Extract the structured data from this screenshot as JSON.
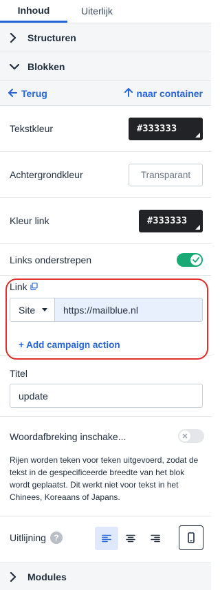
{
  "tabs": [
    {
      "label": "Inhoud",
      "active": true
    },
    {
      "label": "Uiterlijk",
      "active": false
    }
  ],
  "sections": {
    "structuren": "Structuren",
    "blokken": "Blokken",
    "modules": "Modules"
  },
  "nav": {
    "back": "Terug",
    "container": "naar container"
  },
  "fields": {
    "tekstkleur": {
      "label": "Tekstkleur",
      "value": "#333333"
    },
    "achtergrondkleur": {
      "label": "Achtergrondkleur",
      "placeholder": "Transparant"
    },
    "kleur_link": {
      "label": "Kleur link",
      "value": "#333333"
    },
    "links_onderstrepen": {
      "label": "Links onderstrepen",
      "enabled": true
    }
  },
  "link": {
    "label": "Link",
    "type_selected": "Site",
    "url": "https://mailblue.nl",
    "add_action": "+ Add campaign action"
  },
  "titel": {
    "label": "Titel",
    "value": "update"
  },
  "woordafbreking": {
    "label": "Woordafbreking inschake...",
    "enabled": false,
    "help": "Rijen worden teken voor teken uitgevoerd, zodat de tekst in de gespecificeerde breedte van het blok wordt geplaatst. Dit werkt niet voor tekst in het Chinees, Koreaans of Japans."
  },
  "uitlijning": {
    "label": "Uitlijning",
    "help_glyph": "?",
    "selected": "left"
  },
  "colors": {
    "accent": "#2565d6",
    "toggle_on": "#19a974",
    "highlight": "#e0302b",
    "swatch": "#333333"
  }
}
